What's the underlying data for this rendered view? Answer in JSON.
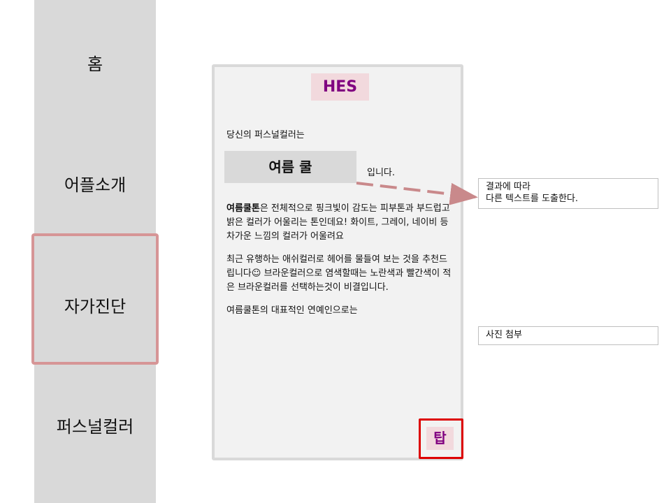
{
  "nav": {
    "home": "홈",
    "about": "어플소개",
    "self_diagnosis": "자가진단",
    "personal_color": "퍼스널컬러"
  },
  "phone": {
    "brand": "HES",
    "intro": "당신의 퍼스널컬러는",
    "result": "여름 쿨",
    "result_suffix": "입니다.",
    "paragraph1_bold": "여름쿨톤",
    "paragraph1_rest": "은 전체적으로 핑크빛이 감도는 피부톤과 부드럽고 밝은 컬러가 어울리는 톤인데요! 화이트, 그레이, 네이비 등 차가운 느낌의 컬러가 어울려요",
    "paragraph2": "최근 유행하는 애쉬컬러로 헤어를 물들여 보는 것을 추천드립니다☺ 브라운컬러으로 염색할때는 노란색과 빨간색이 적은 브라운컬러를 선택하는것이 비결입니다.",
    "paragraph3": "여름쿨톤의 대표적인 연예인으로는",
    "tip_button": "탑"
  },
  "annotations": {
    "result_note_line1": "결과에 따라",
    "result_note_line2": "다른 텍스트를 도출한다.",
    "photo_note": "사진 첨부"
  },
  "colors": {
    "sidebar_bg": "#d9d9d9",
    "highlight_border": "#d69596",
    "brand_bg": "#f2d9dd",
    "brand_text": "#800080",
    "tip_border": "#dd0000",
    "arrow": "#c9898b"
  }
}
